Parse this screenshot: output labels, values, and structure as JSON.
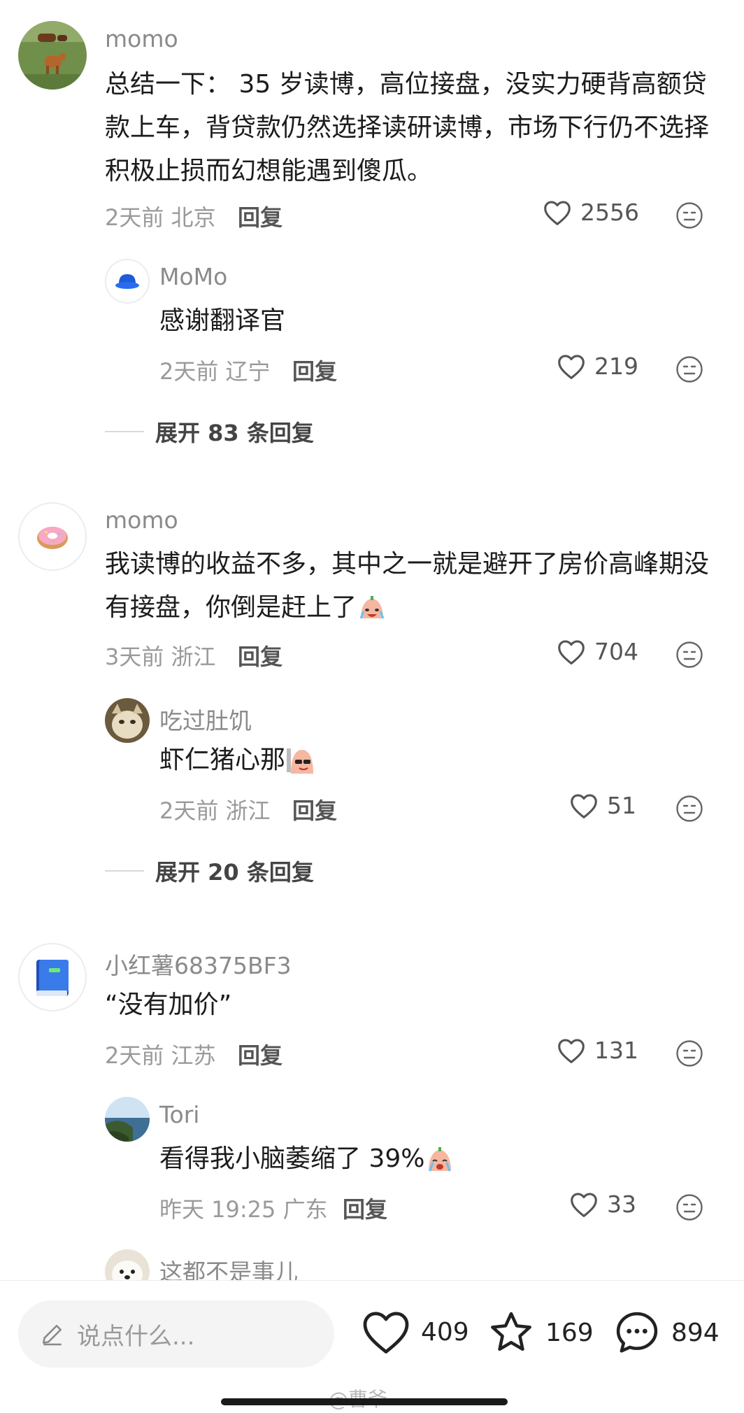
{
  "comments": [
    {
      "username": "momo",
      "text": "总结一下： 35 岁读博，高位接盘，没实力硬背高额贷款上车，背贷款仍然选择读研读博，市场下行仍不选择积极止损而幻想能遇到傻瓜。",
      "time": "2天前",
      "location": "北京",
      "reply_label": "回复",
      "likes": "2556",
      "avatar": "cows-in-field-avatar",
      "replies": [
        {
          "username": "MoMo",
          "text": "感谢翻译官",
          "time": "2天前",
          "location": "辽宁",
          "reply_label": "回复",
          "likes": "219",
          "avatar": "blue-bucket-hat-avatar"
        }
      ],
      "expand_label": "展开 83 条回复"
    },
    {
      "username": "momo",
      "text": "我读博的收益不多，其中之一就是避开了房价高峰期没有接盘，你倒是赶上了",
      "emoji": "crying-laugh-emoji",
      "time": "3天前",
      "location": "浙江",
      "reply_label": "回复",
      "likes": "704",
      "avatar": "donut-avatar",
      "replies": [
        {
          "username": "吃过肚饥",
          "text": "虾仁猪心那",
          "emoji": "sunglasses-emoji",
          "time": "2天前",
          "location": "浙江",
          "reply_label": "回复",
          "likes": "51",
          "avatar": "cat-avatar"
        }
      ],
      "expand_label": "展开 20 条回复"
    },
    {
      "username": "小红薯68375BF3",
      "text": "“没有加价”",
      "time": "2天前",
      "location": "江苏",
      "reply_label": "回复",
      "likes": "131",
      "avatar": "blue-book-avatar",
      "replies": [
        {
          "username": "Tori",
          "text": "看得我小脑萎缩了 39%",
          "emoji": "crying-emoji",
          "time": "昨天 19:25",
          "location": "广东",
          "reply_label": "回复",
          "likes": "33",
          "avatar": "coast-avatar"
        },
        {
          "username": "这都不是事儿",
          "avatar": "puppy-avatar"
        }
      ]
    }
  ],
  "bottom_bar": {
    "input_placeholder": "说点什么...",
    "likes": "409",
    "favorites": "169",
    "comments": "894",
    "watermark": "@曹爷"
  },
  "colors": {
    "text": "#1c1c1c",
    "muted": "#9a9a9a",
    "input_bg": "#f4f4f4"
  }
}
